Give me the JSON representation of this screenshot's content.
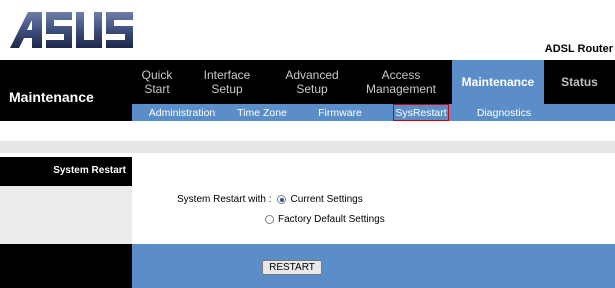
{
  "header": {
    "logo_text": "ASUS",
    "product": "ADSL Router"
  },
  "nav": {
    "section_title": "Maintenance",
    "items": [
      {
        "label": "Quick\nStart"
      },
      {
        "label": "Interface\nSetup"
      },
      {
        "label": "Advanced\nSetup"
      },
      {
        "label": "Access\nManagement"
      },
      {
        "label": "Maintenance"
      },
      {
        "label": "Status"
      }
    ],
    "sub": [
      {
        "label": "Administration"
      },
      {
        "label": "Time Zone"
      },
      {
        "label": "Firmware"
      },
      {
        "label": "SysRestart"
      },
      {
        "label": "Diagnostics"
      }
    ]
  },
  "section": {
    "title": "System Restart",
    "prompt": "System Restart with :",
    "options": [
      {
        "label": "Current Settings",
        "checked": true
      },
      {
        "label": "Factory Default Settings",
        "checked": false
      }
    ]
  },
  "footer": {
    "restart_label": "RESTART"
  },
  "colors": {
    "accent": "#5b8ec8",
    "nav_bg": "#000000"
  }
}
